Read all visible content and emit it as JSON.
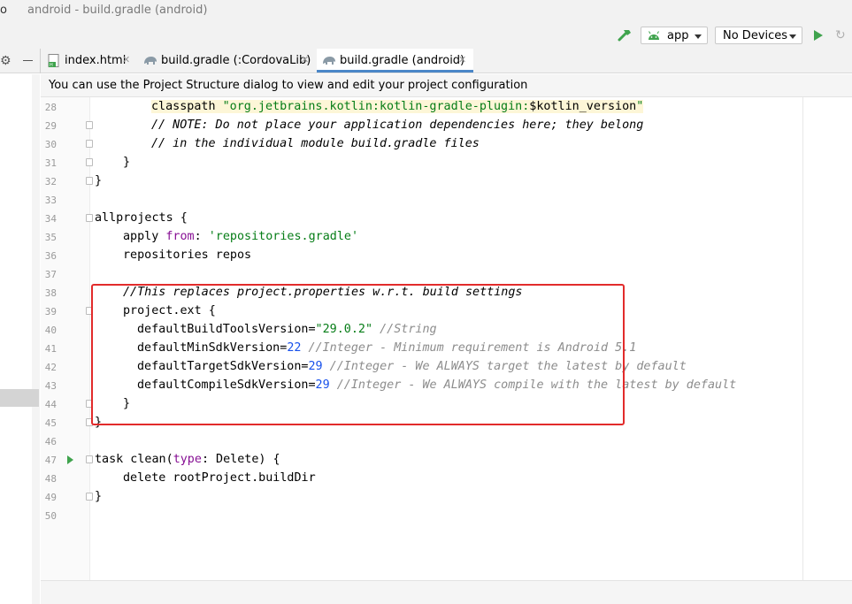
{
  "window": {
    "title": "android - build.gradle (android)",
    "app_glyph": "o"
  },
  "toolbar": {
    "hammer_icon": "hammer-icon",
    "run_config": "app",
    "device": "No Devices",
    "run_icon": "run-icon",
    "rerun_icon": "rerun-icon"
  },
  "tabs": [
    {
      "label": "index.html",
      "icon": "html-file-icon",
      "active": false
    },
    {
      "label": "build.gradle (:CordovaLib)",
      "icon": "gradle-elephant-icon",
      "active": false
    },
    {
      "label": "build.gradle (android)",
      "icon": "gradle-elephant-icon",
      "active": true
    }
  ],
  "notice": {
    "text": "You can use the Project Structure dialog to view and edit your project configuration"
  },
  "editor": {
    "lines": [
      {
        "n": "28",
        "fold": false
      },
      {
        "n": "29",
        "fold": true
      },
      {
        "n": "30",
        "fold": true
      },
      {
        "n": "31",
        "fold": true
      },
      {
        "n": "32",
        "fold": true
      },
      {
        "n": "33",
        "fold": false
      },
      {
        "n": "34",
        "fold": true
      },
      {
        "n": "35",
        "fold": false
      },
      {
        "n": "36",
        "fold": false
      },
      {
        "n": "37",
        "fold": false
      },
      {
        "n": "38",
        "fold": false
      },
      {
        "n": "39",
        "fold": true
      },
      {
        "n": "40",
        "fold": false
      },
      {
        "n": "41",
        "fold": false
      },
      {
        "n": "42",
        "fold": false
      },
      {
        "n": "43",
        "fold": false
      },
      {
        "n": "44",
        "fold": true
      },
      {
        "n": "45",
        "fold": true
      },
      {
        "n": "46",
        "fold": false
      },
      {
        "n": "47",
        "fold": true
      },
      {
        "n": "48",
        "fold": false
      },
      {
        "n": "49",
        "fold": true
      },
      {
        "n": "50",
        "fold": false
      }
    ],
    "code": {
      "l28_a": "classpath ",
      "l28_b": "\"org.jetbrains.kotlin:kotlin-gradle-plugin:",
      "l28_c": "$kotlin_version",
      "l28_d": "\"",
      "l29": "// NOTE: Do not place your application dependencies here; they belong",
      "l30": "// in the individual module build.gradle files",
      "l31": "}",
      "l32": "}",
      "l34": "allprojects {",
      "l35_a": "apply ",
      "l35_b": "from",
      "l35_c": ": ",
      "l35_d": "'repositories.gradle'",
      "l36": "repositories repos",
      "l38": "//This replaces project.properties w.r.t. build settings",
      "l39": "project.ext {",
      "l40_a": "defaultBuildToolsVersion=",
      "l40_b": "\"29.0.2\"",
      "l40_c": " //String",
      "l41_a": "defaultMinSdkVersion=",
      "l41_b": "22",
      "l41_c": " //Integer - Minimum requirement is Android 5.1",
      "l42_a": "defaultTargetSdkVersion=",
      "l42_b": "29",
      "l42_c": " //Integer - We ALWAYS target the latest by default",
      "l43_a": "defaultCompileSdkVersion=",
      "l43_b": "29",
      "l43_c": " //Integer - We ALWAYS compile with the latest by default",
      "l44": "}",
      "l45": "}",
      "l47_a": "task clean(",
      "l47_b": "type",
      "l47_c": ": Delete) {",
      "l48": "delete rootProject.buildDir",
      "l49": "}"
    }
  },
  "colors": {
    "keyword": "#000080",
    "string": "#067d17",
    "number": "#1750eb",
    "comment": "#8c8c8c",
    "annotation_box": "#e22b2b",
    "active_tab_underline": "#4a87c8"
  }
}
